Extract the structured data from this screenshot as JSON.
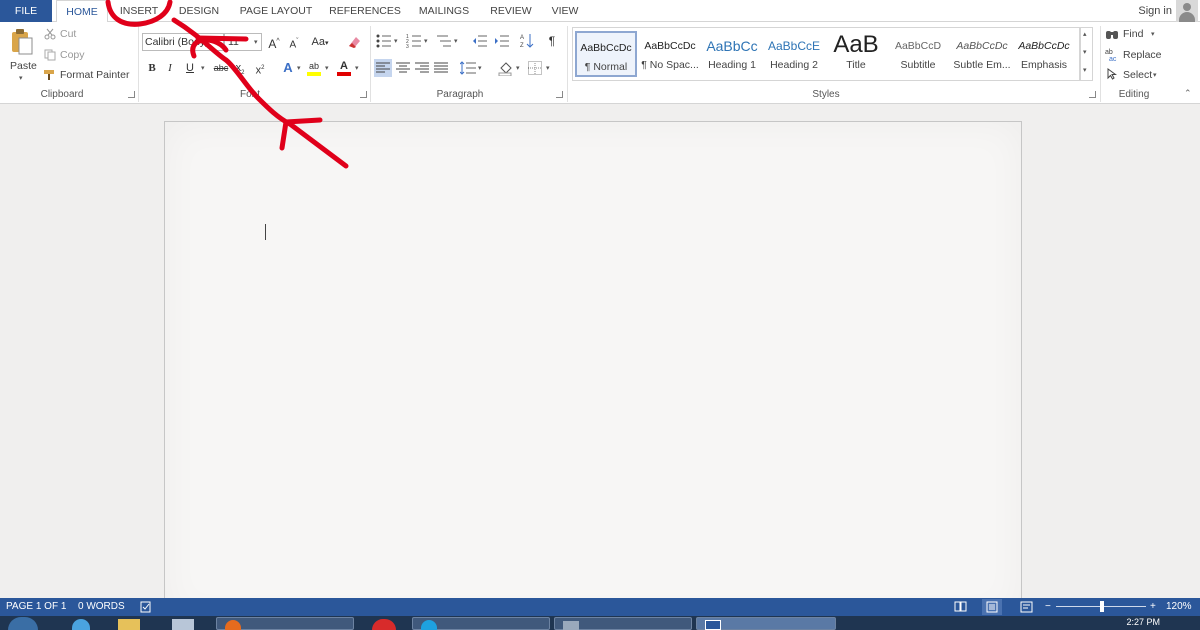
{
  "tabs": {
    "file": "FILE",
    "home": "HOME",
    "insert": "INSERT",
    "design": "DESIGN",
    "page_layout": "PAGE LAYOUT",
    "references": "REFERENCES",
    "mailings": "MAILINGS",
    "review": "REVIEW",
    "view": "VIEW"
  },
  "account": {
    "sign_in": "Sign in"
  },
  "clipboard": {
    "paste": "Paste",
    "cut": "Cut",
    "copy": "Copy",
    "format_painter": "Format Painter",
    "label": "Clipboard"
  },
  "font": {
    "name": "Calibri (Body)",
    "size": "11",
    "label": "Font",
    "bold": "B",
    "italic": "I",
    "underline": "U",
    "strikethrough": "abc",
    "subscript": "x",
    "superscript": "x",
    "change_case": "Aa",
    "grow": "A",
    "shrink": "A",
    "text_effects": "A",
    "highlight": "ab",
    "font_color": "A"
  },
  "paragraph": {
    "label": "Paragraph",
    "pilcrow": "¶"
  },
  "styles": {
    "label": "Styles",
    "items": [
      {
        "sample": "AaBbCcDc",
        "name": "¶ Normal"
      },
      {
        "sample": "AaBbCcDc",
        "name": "¶ No Spac..."
      },
      {
        "sample": "AaBbCc",
        "name": "Heading 1"
      },
      {
        "sample": "AaBbCcE",
        "name": "Heading 2"
      },
      {
        "sample": "AaB",
        "name": "Title"
      },
      {
        "sample": "AaBbCcD",
        "name": "Subtitle"
      },
      {
        "sample": "AaBbCcDc",
        "name": "Subtle Em..."
      },
      {
        "sample": "AaBbCcDc",
        "name": "Emphasis"
      }
    ]
  },
  "editing": {
    "find": "Find",
    "replace": "Replace",
    "select": "Select",
    "label": "Editing"
  },
  "status": {
    "page": "PAGE 1 OF 1",
    "words": "0 WORDS",
    "zoom": "120%",
    "zoom_level_percent": 120,
    "minus": "−",
    "plus": "+"
  },
  "taskbar": {
    "clock": "2:27 PM"
  },
  "colors": {
    "accent": "#2b579a",
    "annotation": "#e0001a",
    "highlight": "#ffff00",
    "font_color": "#e00000"
  }
}
